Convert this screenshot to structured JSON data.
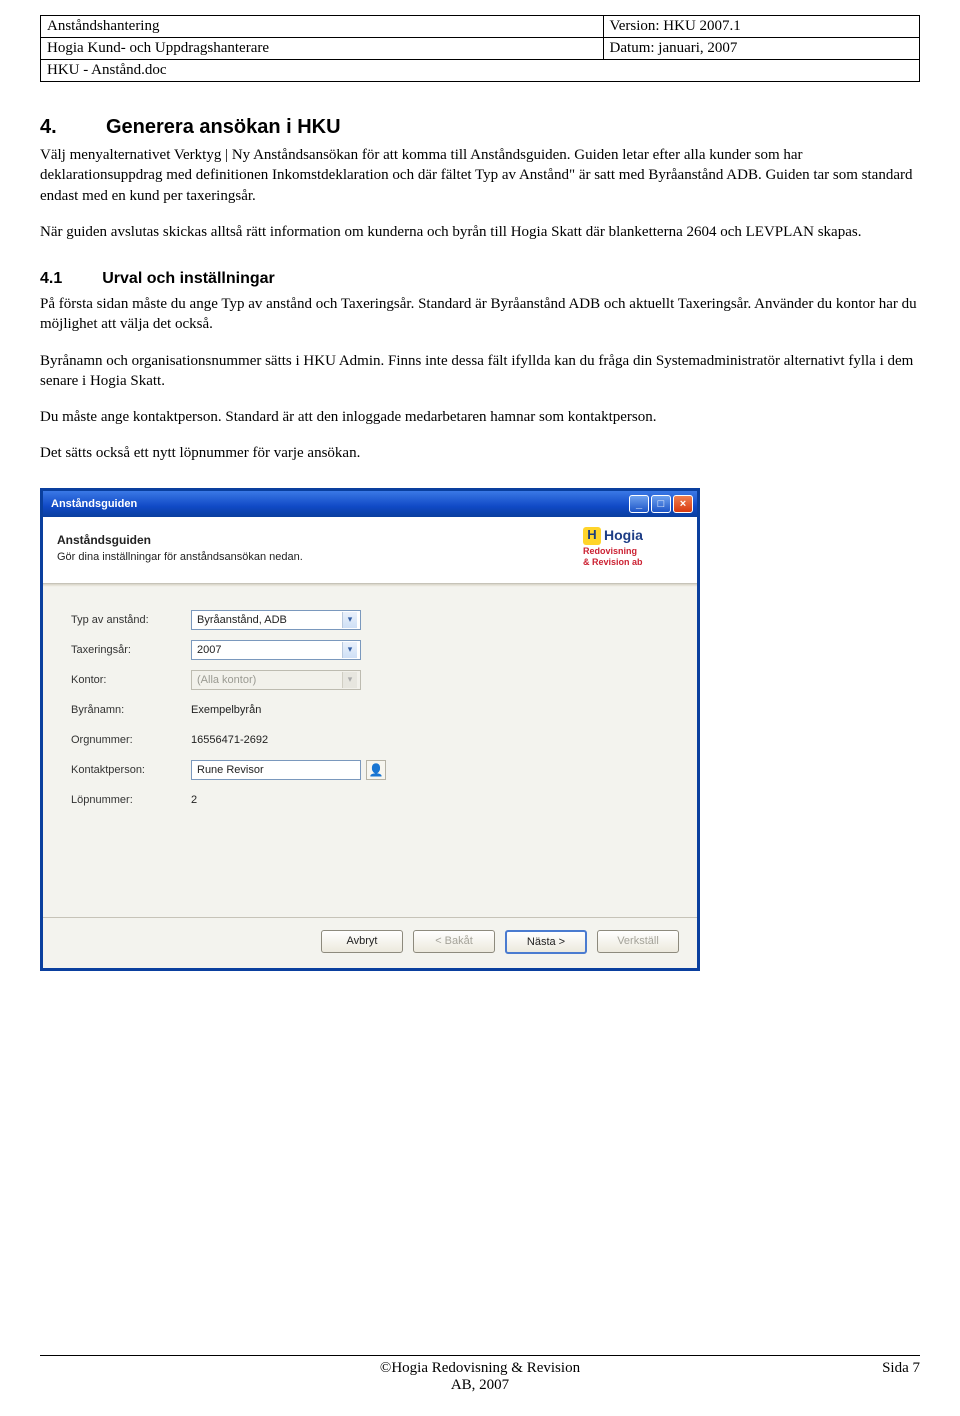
{
  "header": {
    "r1c1": "Anståndshantering",
    "r1c2": "Version: HKU 2007.1",
    "r2c1": "Hogia Kund- och Uppdragshanterare",
    "r2c2": "Datum: januari, 2007",
    "r3c1": "HKU - Anstånd.doc"
  },
  "section": {
    "num": "4.",
    "title": "Generera ansökan i HKU"
  },
  "p1": "Välj menyalternativet Verktyg | Ny Anståndsansökan för att komma till Anståndsguiden. Guiden letar efter alla kunder som har deklarationsuppdrag med definitionen Inkomstdeklaration och där fältet Typ av Anstånd\" är satt med Byråanstånd ADB. Guiden tar som standard endast med en kund per taxeringsår.",
  "p2": "När guiden avslutas skickas alltså rätt information om kunderna och byrån till Hogia Skatt där blanketterna 2604 och LEVPLAN skapas.",
  "subsection": {
    "num": "4.1",
    "title": "Urval och inställningar"
  },
  "p3": "På första sidan måste du ange Typ av anstånd och Taxeringsår. Standard är Byråanstånd ADB och aktuellt Taxeringsår. Använder du kontor har du möjlighet att välja det också.",
  "p4": "Byrånamn och organisationsnummer sätts i HKU Admin. Finns inte dessa fält ifyllda kan du fråga din Systemadministratör alternativt fylla i dem senare i Hogia Skatt.",
  "p5": "Du måste ange kontaktperson. Standard är att den inloggade medarbetaren hamnar som kontaktperson.",
  "p6": "Det sätts också ett nytt löpnummer för varje ansökan.",
  "dialog": {
    "title": "Anståndsguiden",
    "head_title": "Anståndsguiden",
    "head_sub": "Gör dina inställningar för anståndsansökan nedan.",
    "logo_brand": "Hogia",
    "logo_sub1": "Redovisning",
    "logo_sub2": "& Revision ab",
    "labels": {
      "typ": "Typ av anstånd:",
      "tax": "Taxeringsår:",
      "kontor": "Kontor:",
      "byra": "Byrånamn:",
      "org": "Orgnummer:",
      "kontakt": "Kontaktperson:",
      "lop": "Löpnummer:"
    },
    "values": {
      "typ": "Byråanstånd, ADB",
      "tax": "2007",
      "kontor": "(Alla kontor)",
      "byra": "Exempelbyrån",
      "org": "16556471-2692",
      "kontakt": "Rune Revisor",
      "lop": "2"
    },
    "buttons": {
      "cancel": "Avbryt",
      "back": "< Bakåt",
      "next": "Nästa >",
      "apply": "Verkställ"
    }
  },
  "footer": {
    "copyright_l1": "©Hogia Redovisning & Revision",
    "copyright_l2": "AB, 2007",
    "page": "Sida 7"
  }
}
